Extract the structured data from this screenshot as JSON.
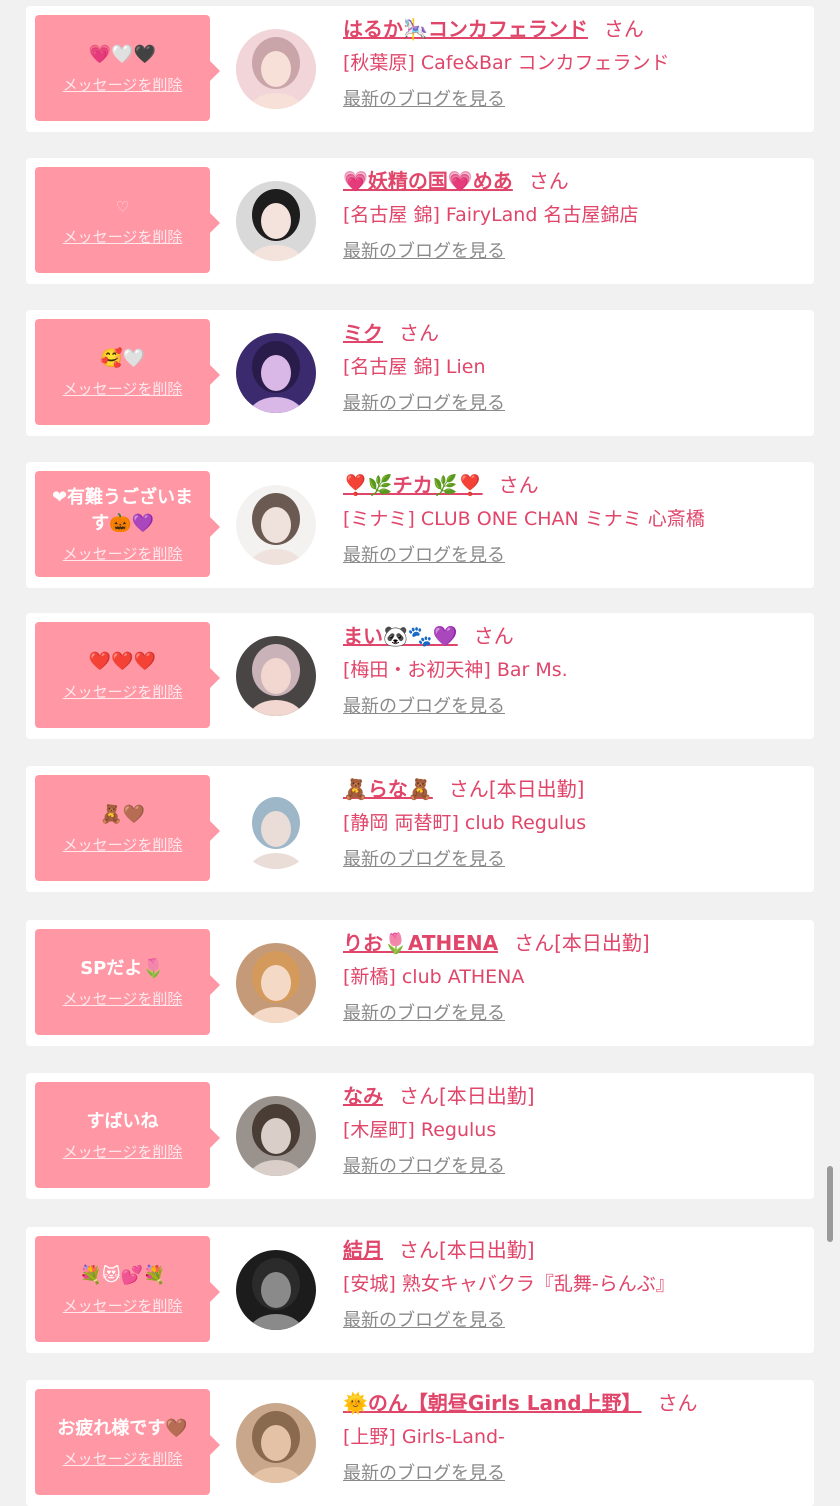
{
  "rows": [
    {
      "message": "💗🤍🖤",
      "delete_label": "メッセージを削除",
      "name": "はるか🎠コンカフェランド",
      "san": "さん",
      "shift": "",
      "shop": "[秋葉原] Cafe&Bar コンカフェランド",
      "blog_label": "最新のブログを見る"
    },
    {
      "message": "♡",
      "delete_label": "メッセージを削除",
      "name": "💗妖精の国💗めあ",
      "san": "さん",
      "shift": "",
      "shop": "[名古屋 錦] FairyLand 名古屋錦店",
      "blog_label": "最新のブログを見る"
    },
    {
      "message": "🥰🤍",
      "delete_label": "メッセージを削除",
      "name": "ミク",
      "san": "さん",
      "shift": "",
      "shop": "[名古屋 錦] Lien",
      "blog_label": "最新のブログを見る"
    },
    {
      "message": "❤有難うございます🎃💜",
      "delete_label": "メッセージを削除",
      "name": "❣️🌿チカ🌿❣️",
      "san": "さん",
      "shift": "",
      "shop": "[ミナミ] CLUB ONE CHAN ミナミ 心斎橋",
      "blog_label": "最新のブログを見る"
    },
    {
      "message": "❤️❤️❤️",
      "delete_label": "メッセージを削除",
      "name": "まい🐼🐾💜",
      "san": "さん",
      "shift": "",
      "shop": "[梅田・お初天神] Bar Ms.",
      "blog_label": "最新のブログを見る"
    },
    {
      "message": "🧸🤎",
      "delete_label": "メッセージを削除",
      "name": "🧸らな🧸",
      "san": "さん",
      "shift": "[本日出勤]",
      "shop": "[静岡 両替町] club Regulus",
      "blog_label": "最新のブログを見る"
    },
    {
      "message": "SPだよ🌷",
      "delete_label": "メッセージを削除",
      "name": "りお🌷ATHENA",
      "san": "さん",
      "shift": "[本日出勤]",
      "shop": "[新橋] club ATHENA",
      "blog_label": "最新のブログを見る"
    },
    {
      "message": "すばいね",
      "delete_label": "メッセージを削除",
      "name": "なみ",
      "san": "さん",
      "shift": "[本日出勤]",
      "shop": "[木屋町] Regulus",
      "blog_label": "最新のブログを見る"
    },
    {
      "message": "💐😻💕💐",
      "delete_label": "メッセージを削除",
      "name": "結月",
      "san": "さん",
      "shift": "[本日出勤]",
      "shop": "[安城] 熟女キャバクラ『乱舞-らんぶ』",
      "blog_label": "最新のブログを見る"
    },
    {
      "message": "お疲れ様です🤎",
      "delete_label": "メッセージを削除",
      "name": "🌞のん【朝昼Girls Land上野】",
      "san": "さん",
      "shift": "",
      "shop": "[上野] Girls-Land-",
      "blog_label": "最新のブログを見る"
    }
  ],
  "avatar_colors": [
    {
      "bg": "#f1d5d9",
      "skin": "#f6e0d8",
      "hair": "#c9a4a8"
    },
    {
      "bg": "#d9d9d9",
      "skin": "#f3e3dc",
      "hair": "#1d1d1d"
    },
    {
      "bg": "#3b2a6e",
      "skin": "#d9b8e8",
      "hair": "#2a1c4a"
    },
    {
      "bg": "#f4f2f1",
      "skin": "#efe2dc",
      "hair": "#6b5a52"
    },
    {
      "bg": "#4a4545",
      "skin": "#f1d7cf",
      "hair": "#c9b3b8"
    },
    {
      "bg": "#ffffff",
      "skin": "#eadcd6",
      "hair": "#9db7c8"
    },
    {
      "bg": "#c59a78",
      "skin": "#f3d9c6",
      "hair": "#d49a5c"
    },
    {
      "bg": "#9a928c",
      "skin": "#d9cfc8",
      "hair": "#4a3d36"
    },
    {
      "bg": "#1c1c1c",
      "skin": "#8a8a8a",
      "hair": "#2b2b2b"
    },
    {
      "bg": "#c8a78a",
      "skin": "#e3c2a5",
      "hair": "#8a6a4e"
    }
  ]
}
